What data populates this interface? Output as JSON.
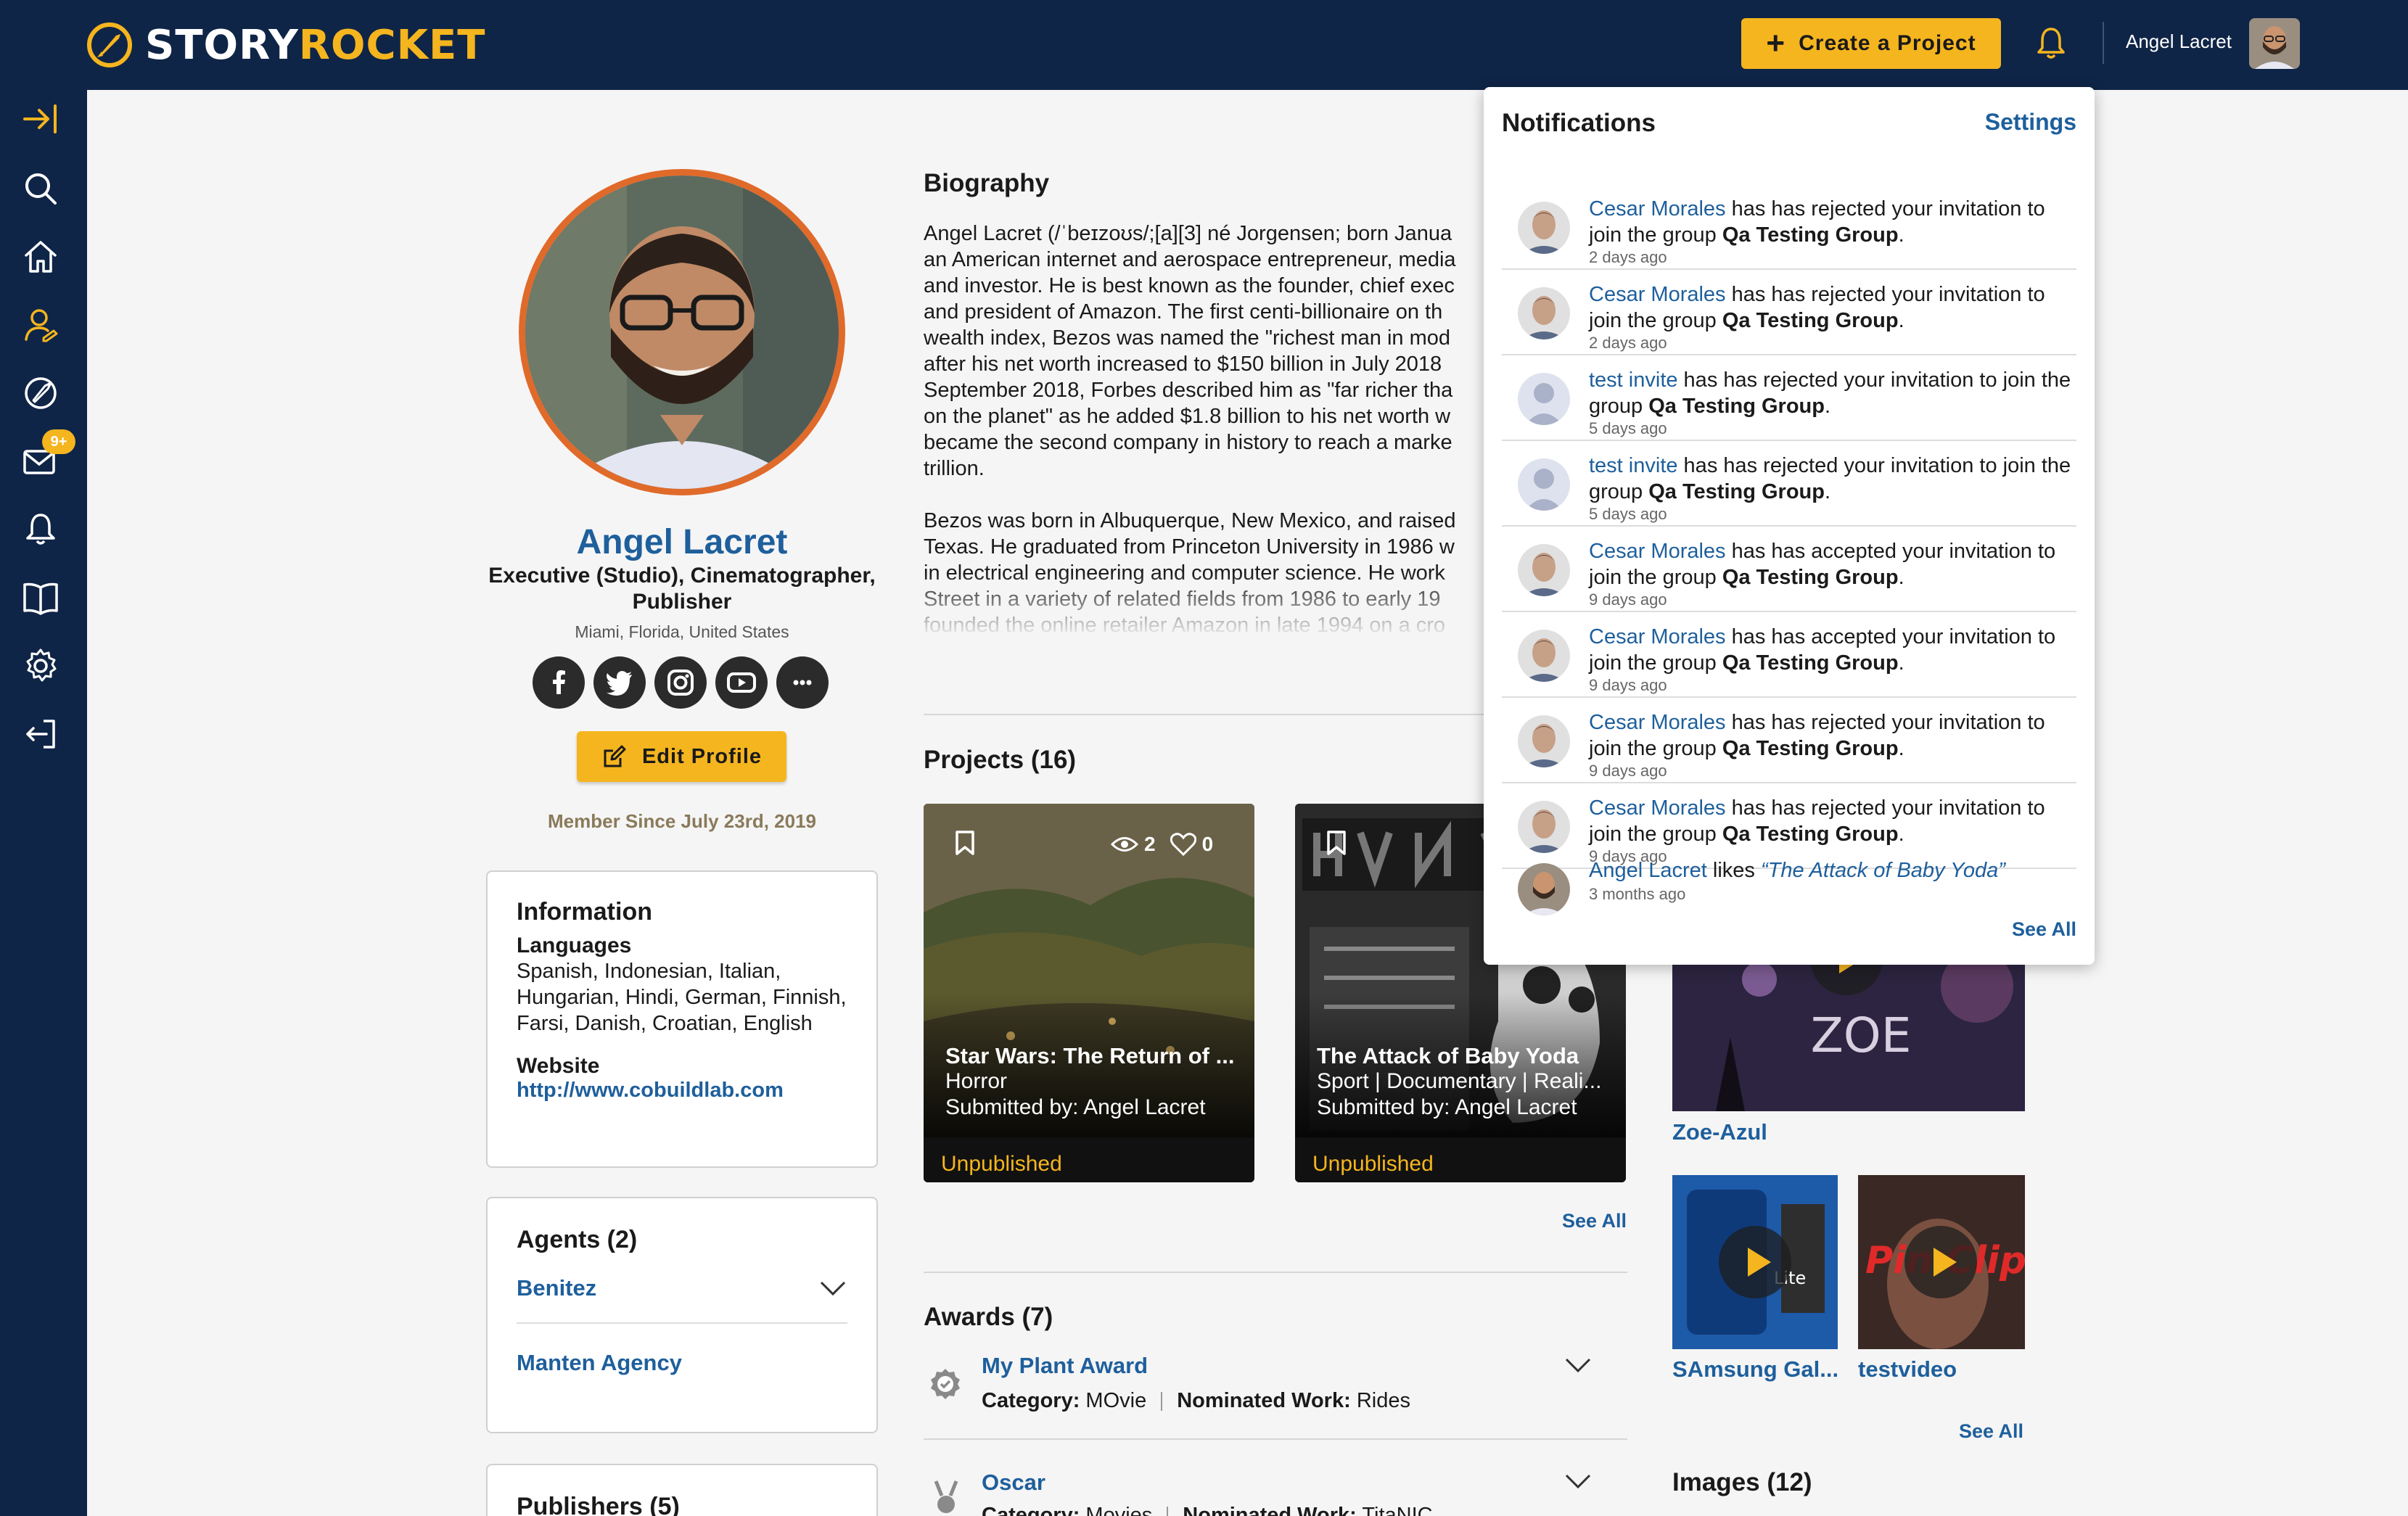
{
  "app": {
    "brand_part1": "STORY",
    "brand_part2": "ROCKET",
    "create_button": "Create a Project",
    "user_name": "Angel Lacret"
  },
  "sidebar": {
    "items": [
      "collapse-icon",
      "search-icon",
      "home-icon",
      "profile-icon",
      "rocket-icon",
      "mail-icon",
      "bell-icon",
      "book-icon",
      "gear-icon",
      "logout-icon"
    ],
    "mail_badge": "9+"
  },
  "profile": {
    "name": "Angel Lacret",
    "roles": "Executive (Studio), Cinematographer, Publisher",
    "location": "Miami, Florida, United States",
    "socials": [
      "facebook-icon",
      "twitter-icon",
      "instagram-icon",
      "youtube-icon",
      "more-icon"
    ],
    "edit_button": "Edit Profile",
    "member_since": "Member Since July 23rd, 2019"
  },
  "information": {
    "title": "Information",
    "languages_label": "Languages",
    "languages": "Spanish, Indonesian, Italian, Hungarian, Hindi, German, Finnish, Farsi, Danish, Croatian, English",
    "website_label": "Website",
    "website": "http://www.cobuildlab.com"
  },
  "agents": {
    "title": "Agents (2)",
    "items": [
      "Benitez",
      "Manten Agency"
    ]
  },
  "publishers": {
    "title": "Publishers (5)"
  },
  "biography": {
    "title": "Biography",
    "text": "Angel Lacret (/ˈbeɪzoʊs/;[a][3] né Jorgensen; born Janua\nan American internet and aerospace entrepreneur, media\nand investor. He is best known as the founder, chief exec\nand president of Amazon. The first centi-billionaire on th\nwealth index, Bezos was named the \"richest man in mod\nafter his net worth increased to $150 billion in July 2018\nSeptember 2018, Forbes described him as \"far richer tha\non the planet\" as he added $1.8 billion to his net worth w\nbecame the second company in history to reach a marke\ntrillion.\n\nBezos was born in Albuquerque, New Mexico, and raised\nTexas. He graduated from Princeton University in 1986 w\nin electrical engineering and computer science. He work\nStreet in a variety of related fields from 1986 to early 19\nfounded the online retailer Amazon in late 1994 on a cro"
  },
  "projects": {
    "title": "Projects (16)",
    "see_all": "See All",
    "items": [
      {
        "title": "Star Wars: The Return of ...",
        "genre": "Horror",
        "submitted_label": "Submitted by:",
        "submitted_by": "Angel Lacret",
        "status": "Unpublished",
        "views": "2",
        "likes": "0"
      },
      {
        "title": "The Attack of Baby Yoda",
        "genre": "Sport | Documentary | Reali...",
        "submitted_label": "Submitted by:",
        "submitted_by": "Angel Lacret",
        "status": "Unpublished"
      }
    ]
  },
  "awards": {
    "title": "Awards (7)",
    "category_label": "Category:",
    "nominated_label": "Nominated Work:",
    "items": [
      {
        "name": "My Plant Award",
        "category": "MOvie",
        "nominated_work": "Rides"
      },
      {
        "name": "Oscar",
        "category": "Movies",
        "nominated_work": "TitaNIC"
      }
    ]
  },
  "videos": {
    "see_all": "See All",
    "items": [
      {
        "label": "Zoe-Azul",
        "thumb_text": "ZOE"
      },
      {
        "label": "SAmsung Gal...",
        "thumb_text": "Lite"
      },
      {
        "label": "testvideo",
        "thumb_text": "Pin Clip"
      }
    ]
  },
  "images": {
    "title": "Images (12)"
  },
  "notifications": {
    "title": "Notifications",
    "settings": "Settings",
    "see_all": "See All",
    "items": [
      {
        "who": "Cesar Morales",
        "action": " has has rejected your invitation to join the group ",
        "group": "Qa Testing Group",
        "end": ".",
        "time": "2 days ago",
        "avatar": "photo"
      },
      {
        "who": "Cesar Morales",
        "action": " has has rejected your invitation to join the group ",
        "group": "Qa Testing Group",
        "end": ".",
        "time": "2 days ago",
        "avatar": "photo"
      },
      {
        "who": "test invite",
        "action": " has has rejected your invitation to join the group ",
        "group": "Qa Testing Group",
        "end": ".",
        "time": "5 days ago",
        "avatar": "default"
      },
      {
        "who": "test invite",
        "action": " has has rejected your invitation to join the group ",
        "group": "Qa Testing Group",
        "end": ".",
        "time": "5 days ago",
        "avatar": "default"
      },
      {
        "who": "Cesar Morales",
        "action": " has has accepted your invitation to join the group ",
        "group": "Qa Testing Group",
        "end": ".",
        "time": "9 days ago",
        "avatar": "photo"
      },
      {
        "who": "Cesar Morales",
        "action": " has has accepted your invitation to join the group ",
        "group": "Qa Testing Group",
        "end": ".",
        "time": "9 days ago",
        "avatar": "photo"
      },
      {
        "who": "Cesar Morales",
        "action": " has has rejected your invitation to join the group ",
        "group": "Qa Testing Group",
        "end": ".",
        "time": "9 days ago",
        "avatar": "photo"
      },
      {
        "who": "Cesar Morales",
        "action": " has has rejected your invitation to join the group ",
        "group": "Qa Testing Group",
        "end": ".",
        "time": "9 days ago",
        "avatar": "photo"
      }
    ],
    "like_item": {
      "who": "Angel Lacret",
      "action": " likes ",
      "work": "“The Attack of Baby Yoda”",
      "time": "3 months ago"
    }
  },
  "colors": {
    "navy": "#0f2547",
    "accent": "#f5b51f",
    "link": "#1e5f9c",
    "avatar_ring": "#e06a2a"
  }
}
